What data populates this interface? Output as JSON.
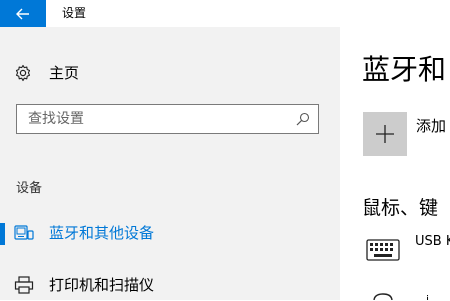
{
  "window": {
    "title": "设置",
    "back_icon": "back-arrow-icon"
  },
  "sidebar": {
    "home": {
      "label": "主页",
      "icon": "gear-icon"
    },
    "search": {
      "placeholder": "查找设置",
      "icon": "search-icon"
    },
    "section_header": "设备",
    "items": [
      {
        "label": "蓝牙和其他设备",
        "icon": "bluetooth-devices-icon",
        "selected": true
      },
      {
        "label": "打印机和扫描仪",
        "icon": "printer-icon",
        "selected": false
      }
    ]
  },
  "content": {
    "title": "蓝牙和",
    "add_device": {
      "icon": "plus-icon",
      "label": "添加"
    },
    "subsection_title": "鼠标、键",
    "devices": [
      {
        "label": "USB K",
        "icon": "keyboard-icon"
      },
      {
        "label": "i",
        "icon": "mouse-icon"
      }
    ]
  },
  "colors": {
    "accent": "#0078d7",
    "sidebar_bg": "#f2f2f2",
    "add_tile_bg": "#cccccc"
  }
}
